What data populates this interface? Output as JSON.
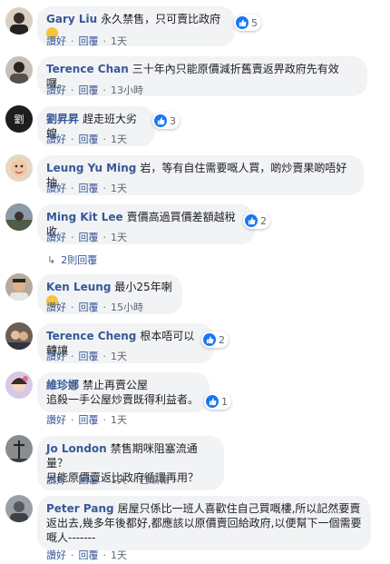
{
  "comments": [
    {
      "name": "Gary Liu",
      "text": "永久禁售，只可賣比政府",
      "like_count": "5",
      "like_label": "讚好",
      "reply_label": "回覆",
      "time": "1天"
    },
    {
      "name": "Terence Chan",
      "text": "三十年內只能原價減折舊賣返畀政府先有效囉。",
      "like_label": "讚好",
      "reply_label": "回覆",
      "time": "13小時"
    },
    {
      "name": "劉昇昇",
      "text": "趕走班大劣蝗",
      "like_count": "3",
      "like_label": "讚好",
      "reply_label": "回覆",
      "time": "1天"
    },
    {
      "name": "Leung Yu Ming",
      "text": "岩，等有自住需要嘅人買，啲炒賣果啲唔好抽",
      "like_label": "讚好",
      "reply_label": "回覆",
      "time": "1天"
    },
    {
      "name": "Ming Kit Lee",
      "text": "賣價高過買價差額越稅收",
      "like_count": "2",
      "like_label": "讚好",
      "reply_label": "回覆",
      "time": "1天",
      "replies_label": "2則回覆"
    },
    {
      "name": "Ken Leung",
      "text": "最小25年喇",
      "like_label": "讚好",
      "reply_label": "回覆",
      "time": "15小時"
    },
    {
      "name": "Terence Cheng",
      "text": "根本唔可以轉讓",
      "like_count": "2",
      "like_label": "讚好",
      "reply_label": "回覆",
      "time": "1天"
    },
    {
      "name": "維珍娜",
      "text": "禁止再賣公屋\n追殺一手公屋炒賣既得利益者。",
      "like_count": "1",
      "like_label": "讚好",
      "reply_label": "回覆",
      "time": "1天"
    },
    {
      "name": "Jo London",
      "text": "禁售期咪阻塞流通量？\n只能原價賣返比政府循環再用？",
      "like_label": "讚好",
      "reply_label": "回覆",
      "time": "1天",
      "edited": "已編輯"
    },
    {
      "name": "Peter Pang",
      "text": "居屋只係比一班人喜歡住自己買嘅樓,所以記然要賣返出去,幾多年後都好,都應該以原價賣回給政府,以便幫下一個需要嘅人-------",
      "like_label": "讚好",
      "reply_label": "回覆",
      "time": "1天"
    }
  ],
  "colors": {
    "name": "#385898",
    "bubble": "#f2f3f5",
    "like": "#1877f2",
    "meta": "#606770"
  }
}
